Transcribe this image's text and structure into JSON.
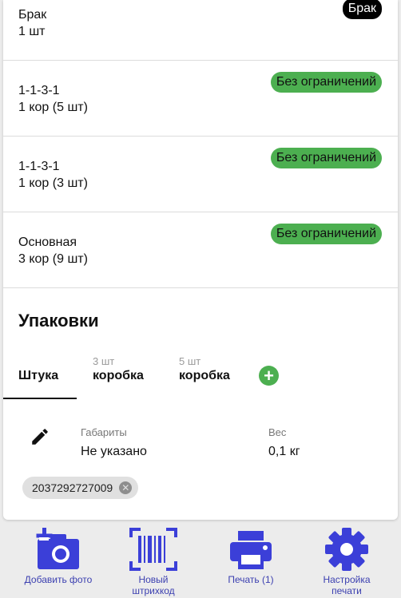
{
  "stock_rows": [
    {
      "name": "Брак",
      "qty": "1 шт",
      "badge": "Брак"
    },
    {
      "name": "1-1-3-1",
      "qty": "1 кор (5 шт)",
      "badge": "Без ограничений"
    },
    {
      "name": "1-1-3-1",
      "qty": "1 кор (3 шт)",
      "badge": "Без ограничений"
    },
    {
      "name": "Основная",
      "qty": "3 кор (9 шт)",
      "badge": "Без ограничений"
    }
  ],
  "packages": {
    "title": "Упаковки",
    "tabs": [
      {
        "sub": "",
        "label": "Штука"
      },
      {
        "sub": "3 шт",
        "label": "коробка"
      },
      {
        "sub": "5 шт",
        "label": "коробка"
      }
    ],
    "add_symbol": "+"
  },
  "details": {
    "dimensions_label": "Габариты",
    "dimensions_value": "Не указано",
    "weight_label": "Вес",
    "weight_value": "0,1 кг"
  },
  "barcode_chip": {
    "value": "2037292727009",
    "close_symbol": "✕"
  },
  "actions": [
    {
      "label_line1": "Добавить фото",
      "label_line2": "",
      "icon": "add-photo-icon"
    },
    {
      "label_line1": "Новый",
      "label_line2": "штрихкод",
      "icon": "barcode-scan-icon"
    },
    {
      "label_line1": "Печать (1)",
      "label_line2": "",
      "icon": "printer-icon"
    },
    {
      "label_line1": "Настройка",
      "label_line2": "печати",
      "icon": "gear-icon"
    }
  ],
  "colors": {
    "badge_green": "#4caf50",
    "badge_black": "#000000",
    "action_icon": "#3b3fd8",
    "action_label": "#3b3fb0"
  }
}
